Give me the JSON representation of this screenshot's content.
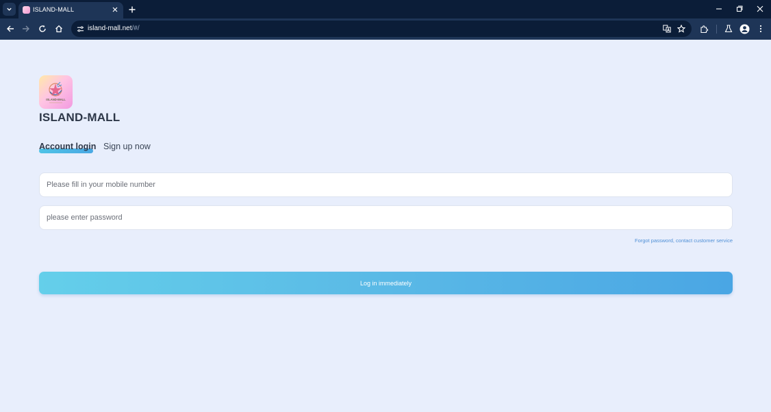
{
  "browser": {
    "tab_title": "ISLAND-MALL",
    "url_host": "island-mall.net",
    "url_path": "/#/"
  },
  "page": {
    "logo_text": "ISLAND-MALL",
    "brand_title": "ISLAND-MALL",
    "tabs": {
      "login": "Account login",
      "signup": "Sign up now"
    },
    "mobile_placeholder": "Please fill in your mobile number",
    "password_placeholder": "please enter password",
    "forgot_link": "Forgot password, contact customer service",
    "login_button": "Log in immediately"
  },
  "colors": {
    "background": "#e8eefc",
    "accent_start": "#64cfea",
    "accent_end": "#4aa6e4",
    "link": "#4f8fd6",
    "chrome_dark": "#0b1d38",
    "chrome_toolbar": "#1e3557"
  },
  "icons": [
    "tab-list-icon",
    "favicon-icon",
    "close-icon",
    "plus-icon",
    "minimize-icon",
    "restore-icon",
    "window-close-icon",
    "back-arrow-icon",
    "forward-arrow-icon",
    "reload-icon",
    "home-icon",
    "site-info-icon",
    "translate-icon",
    "star-icon",
    "extensions-icon",
    "labs-icon",
    "profile-icon",
    "more-vert-icon"
  ]
}
